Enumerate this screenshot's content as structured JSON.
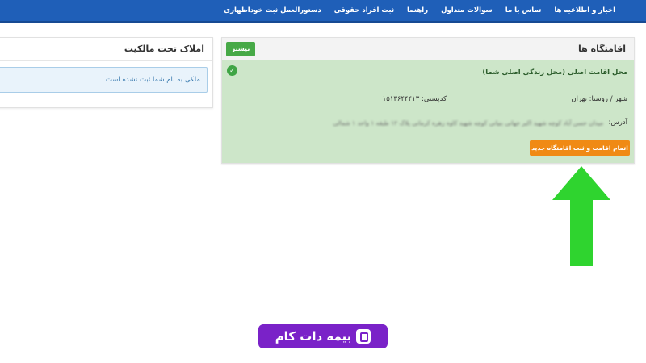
{
  "nav": {
    "items": [
      "اخبار و اطلاعیه ها",
      "تماس با ما",
      "سوالات متداول",
      "راهنما",
      "ثبت افراد حقوقی",
      "دستورالعمل ثبت خوداظهاری"
    ]
  },
  "residences": {
    "title": "اقامتگاه ها",
    "more_label": "بیشتر",
    "main_residence": "محل اقامت اصلی (محل زندگی اصلی شما)",
    "city_label": "شهر / روستا: تهران",
    "postal_label": "کدپستی: ۱۵۱۳۶۴۴۴۱۳",
    "address_label": "آدرس:",
    "address_value": "میدان حسن آباد کوچه شهید اکبر جهانی بنیانی کوچه شهید کاوه زهره کرمانی پلاک ۱۲ طبقه ۱ واحد ۱ شمالی",
    "finish_button": "اتمام اقامت و ثبت اقامتگاه جدید"
  },
  "properties": {
    "title": "املاک تحت مالکیت",
    "alert": "ملکی به نام شما ثبت نشده است"
  },
  "brand": {
    "text": "بیمه دات کام"
  },
  "colors": {
    "nav": "#1f5fb8",
    "success_bg": "#cde6c9",
    "more_button": "#47a947",
    "finish_button": "#f08a14",
    "arrow": "#2fd42f",
    "brand": "#7a22c8"
  }
}
